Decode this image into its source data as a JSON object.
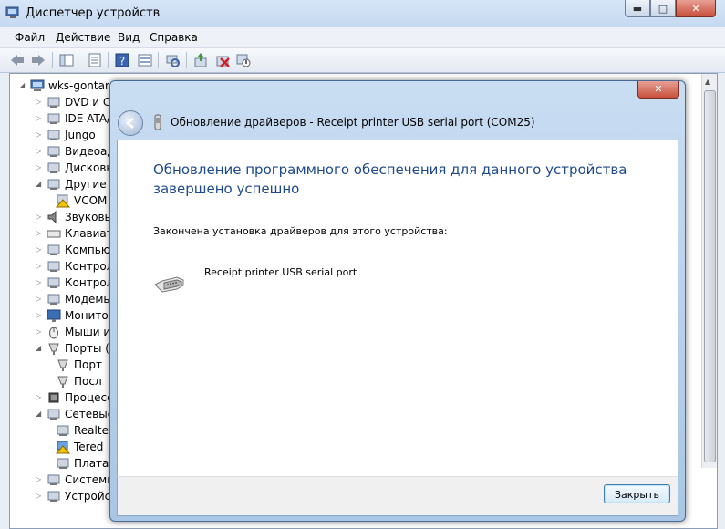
{
  "window": {
    "title": "Диспетчер устройств",
    "minimize": "▬",
    "maximize": "□",
    "close": "✕"
  },
  "menu": [
    "Файл",
    "Действие",
    "Вид",
    "Справка"
  ],
  "tree": {
    "root": "wks-gontar",
    "items": [
      {
        "label": "DVD и CD",
        "icon": "dvd-drive-icon"
      },
      {
        "label": "IDE ATA/A",
        "icon": "ide-controller-icon"
      },
      {
        "label": "Jungo",
        "icon": "jungo-device-icon"
      },
      {
        "label": "Видеоада",
        "icon": "display-adapter-icon"
      },
      {
        "label": "Дисковы",
        "icon": "disk-drive-icon"
      },
      {
        "label": "Другие у",
        "icon": "unknown-device-icon"
      },
      {
        "label": "VCOM",
        "icon": "warning-device-icon"
      },
      {
        "label": "Звуковы",
        "icon": "speaker-icon"
      },
      {
        "label": "Клавиату",
        "icon": "keyboard-icon"
      },
      {
        "label": "Компьют",
        "icon": "computer-icon"
      },
      {
        "label": "Контролл",
        "icon": "usb-controller-icon"
      },
      {
        "label": "Контролл",
        "icon": "storage-controller-icon"
      },
      {
        "label": "Модемы",
        "icon": "modem-icon"
      },
      {
        "label": "Монитор",
        "icon": "monitor-icon"
      },
      {
        "label": "Мыши и",
        "icon": "mouse-icon"
      },
      {
        "label": "Порты (С",
        "icon": "ports-icon"
      },
      {
        "label": "Порт",
        "icon": "port-icon"
      },
      {
        "label": "Посл",
        "icon": "port-icon"
      },
      {
        "label": "Процессо",
        "icon": "processor-icon"
      },
      {
        "label": "Сетевые",
        "icon": "network-adapter-icon"
      },
      {
        "label": "Realte",
        "icon": "network-card-icon"
      },
      {
        "label": "Tered",
        "icon": "network-warning-icon"
      },
      {
        "label": "Плата",
        "icon": "network-card-icon"
      },
      {
        "label": "Системн",
        "icon": "system-device-icon"
      },
      {
        "label": "Устройст",
        "icon": "hid-device-icon"
      }
    ]
  },
  "dialog": {
    "close": "✕",
    "title": "Обновление драйверов - Receipt printer USB serial port (COM25)",
    "main_instruction": "Обновление программного обеспечения для данного устройства завершено успешно",
    "description": "Закончена установка драйверов для этого устройства:",
    "device_name": "Receipt printer USB serial port",
    "close_button": "Закрыть"
  },
  "colors": {
    "instruction_blue": "#1e4a8c",
    "frame_blue": "#a9c6e6",
    "close_red": "#c7503c"
  }
}
